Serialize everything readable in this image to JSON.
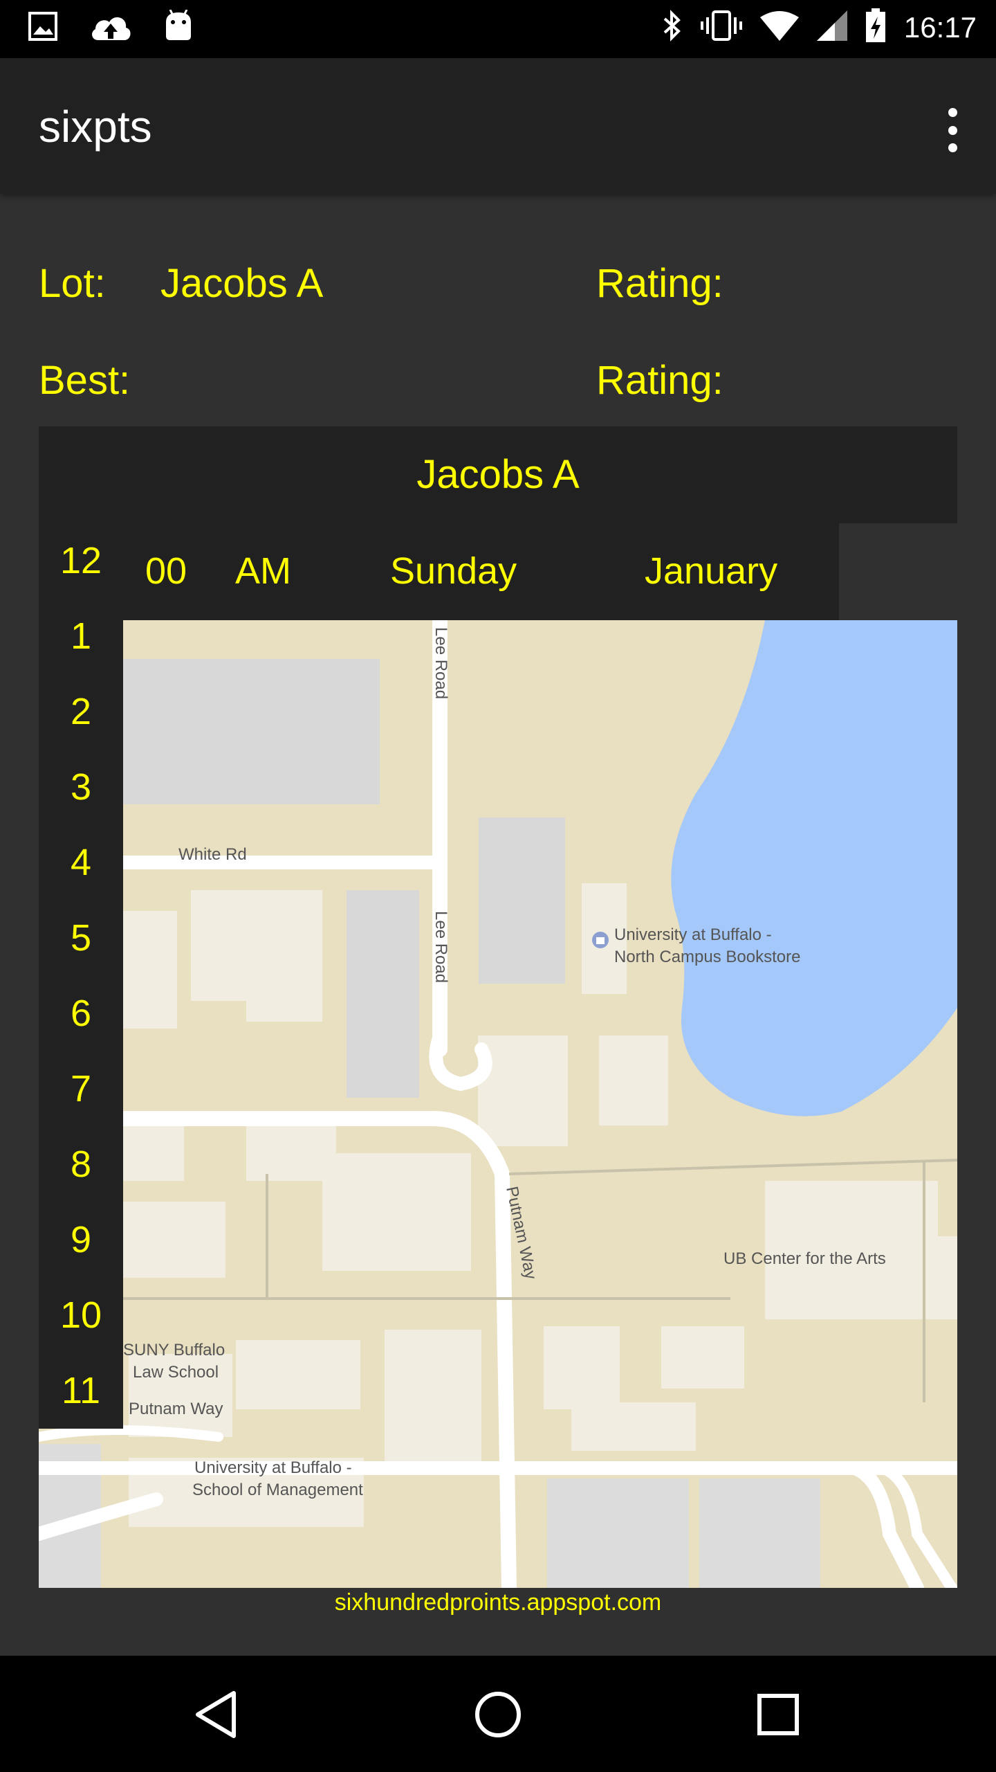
{
  "status_bar": {
    "time": "16:17",
    "left_icons": [
      "image-icon",
      "cloud-upload-icon",
      "android-icon"
    ],
    "right_icons": [
      "bluetooth-icon",
      "vibrate-icon",
      "wifi-icon",
      "signal-icon",
      "battery-icon"
    ]
  },
  "app_bar": {
    "title": "sixpts",
    "menu_icon": "more-vert-icon"
  },
  "info": {
    "lot_label": "Lot:",
    "lot_value": "Jacobs A",
    "rating_label_1": "Rating:",
    "best_label": "Best:",
    "rating_label_2": "Rating:"
  },
  "map_card": {
    "header_title": "Jacobs A",
    "picker": {
      "minute": "00",
      "ampm": "AM",
      "day": "Sunday",
      "month": "January"
    },
    "hour_options": [
      "12",
      "1",
      "2",
      "3",
      "4",
      "5",
      "6",
      "7",
      "8",
      "9",
      "10",
      "11"
    ]
  },
  "map_labels": {
    "lee_road_top": "Lee Road",
    "lee_road_mid": "Lee Road",
    "white_rd": "White Rd",
    "bookstore_line1": "University at Buffalo -",
    "bookstore_line2": "North Campus Bookstore",
    "putnam_way_vertical": "Putnam Way",
    "ub_center": "UB Center for the Arts",
    "law_school_line1": "SUNY Buffalo",
    "law_school_line2": "Law School",
    "putnam_way_horizontal": "Putnam Way",
    "management_line1": "University at Buffalo -",
    "management_line2": "School of Management"
  },
  "footer": {
    "link": "sixhundredproints.appspot.com"
  },
  "nav_bar": {
    "icons": [
      "back-icon",
      "home-icon",
      "recents-icon"
    ]
  },
  "colors": {
    "accent_text": "#ffff00",
    "background": "#303030",
    "app_bar": "#212121",
    "map_land": "#e9dfc1",
    "map_water": "#a4c8fa",
    "map_building": "#d8d8d8"
  }
}
